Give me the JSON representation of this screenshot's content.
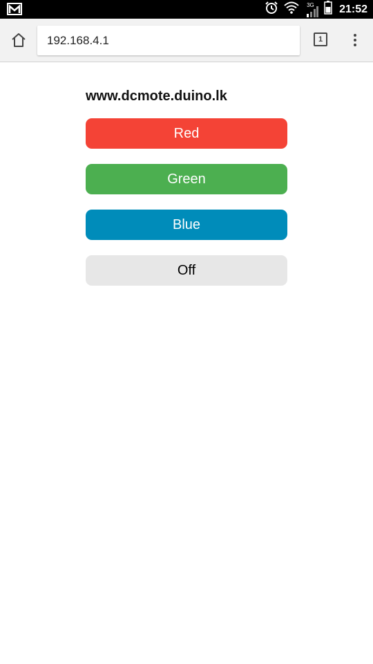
{
  "status_bar": {
    "time": "21:52",
    "network": "3G",
    "icons": [
      "gmail-icon",
      "alarm-icon",
      "wifi-icon",
      "signal-icon",
      "battery-icon"
    ]
  },
  "browser": {
    "url": "192.168.4.1",
    "tab_count": "1",
    "icons": [
      "home-icon",
      "tabs-icon",
      "overflow-menu-icon"
    ]
  },
  "page": {
    "title": "www.dcmote.duino.lk",
    "buttons": [
      {
        "label": "Red",
        "color": "#f44336",
        "text_color": "#ffffff"
      },
      {
        "label": "Green",
        "color": "#4caf50",
        "text_color": "#ffffff"
      },
      {
        "label": "Blue",
        "color": "#008cba",
        "text_color": "#ffffff"
      },
      {
        "label": "Off",
        "color": "#e7e7e7",
        "text_color": "#000000"
      }
    ]
  }
}
